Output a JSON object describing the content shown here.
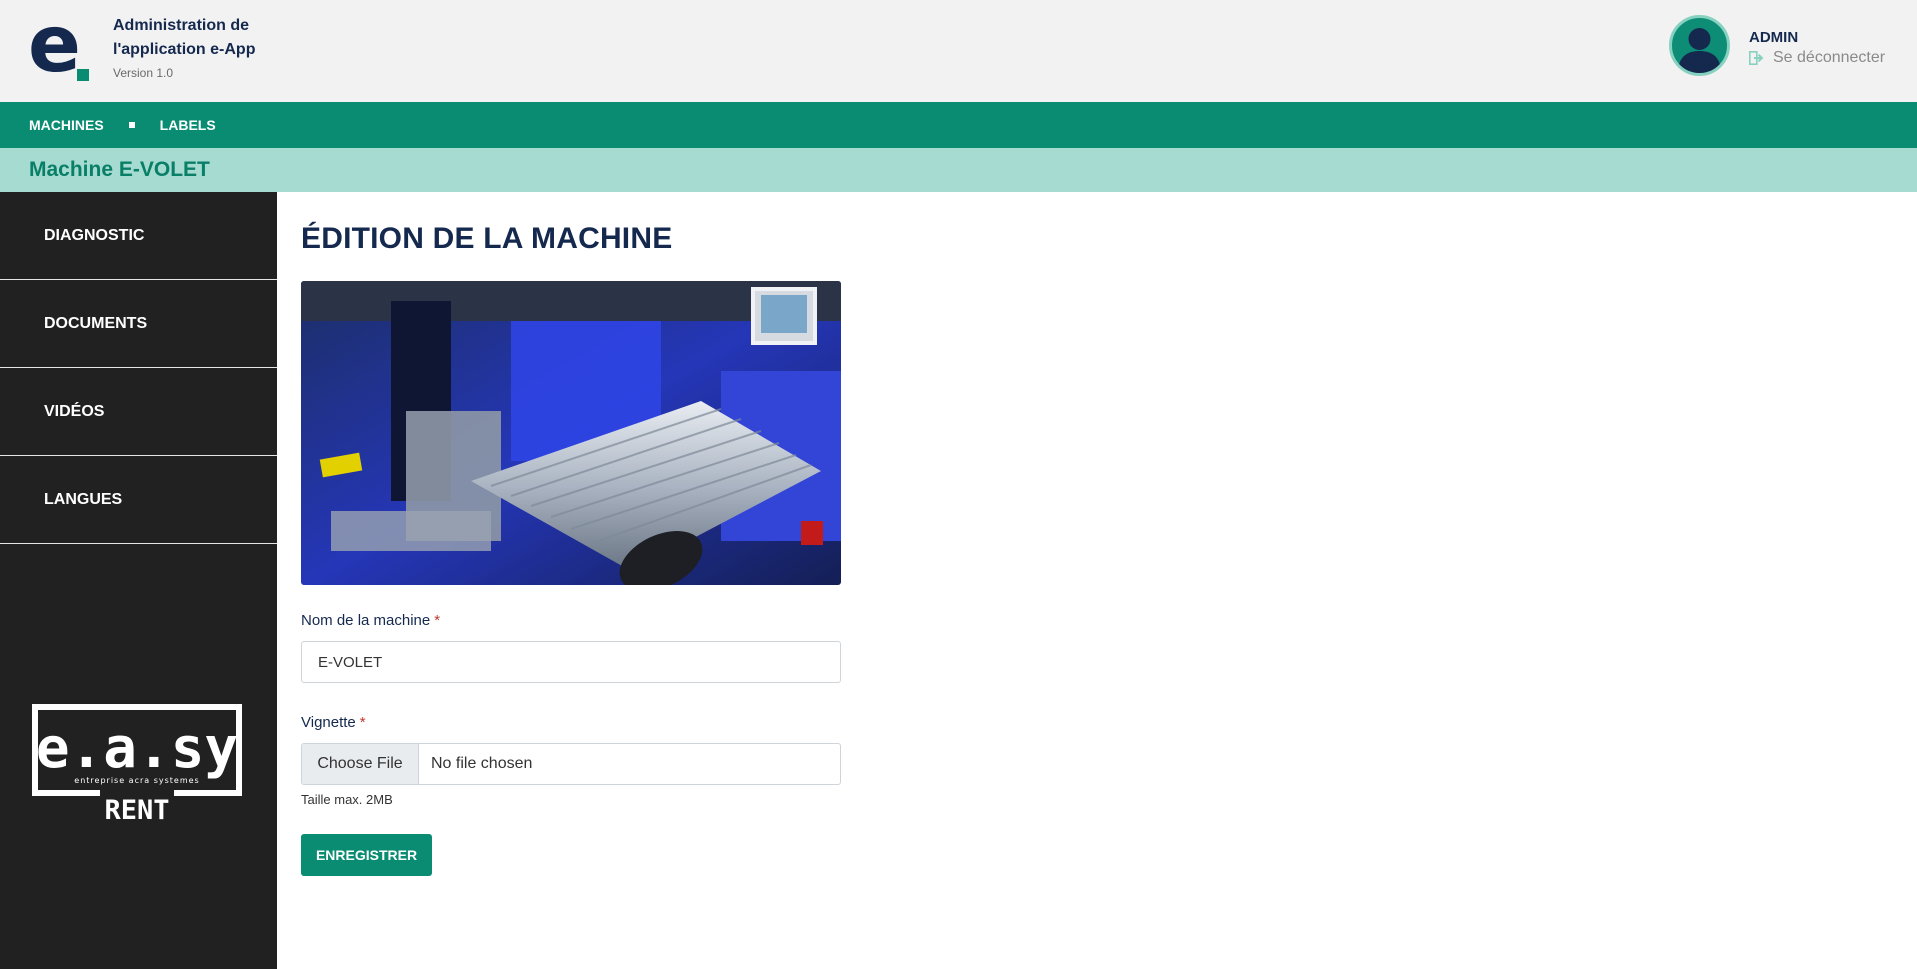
{
  "header": {
    "app_title": "Administration de l'application e-App",
    "version": "Version 1.0",
    "user": {
      "name": "ADMIN",
      "logout_label": "Se déconnecter"
    }
  },
  "nav": {
    "items": [
      {
        "label": "MACHINES"
      },
      {
        "label": "LABELS"
      }
    ]
  },
  "subbar": {
    "title": "Machine E-VOLET"
  },
  "sidebar": {
    "items": [
      {
        "label": "DIAGNOSTIC"
      },
      {
        "label": "DOCUMENTS"
      },
      {
        "label": "VIDÉOS"
      },
      {
        "label": "LANGUES"
      }
    ],
    "brand": {
      "name": "e.a.sy",
      "tagline": "entreprise acra systemes",
      "suffix": "RENT"
    }
  },
  "main": {
    "page_title": "ÉDITION DE LA MACHINE",
    "form": {
      "name_label": "Nom de la machine",
      "name_value": "E-VOLET",
      "required_mark": "*",
      "thumbnail_label": "Vignette",
      "file_button": "Choose File",
      "file_status": "No file chosen",
      "file_help": "Taille max. 2MB",
      "submit_label": "ENREGISTRER"
    }
  },
  "colors": {
    "accent": "#0a8c72",
    "subbar": "#a5dbd1",
    "sidebar": "#212121",
    "navy": "#15294f"
  }
}
